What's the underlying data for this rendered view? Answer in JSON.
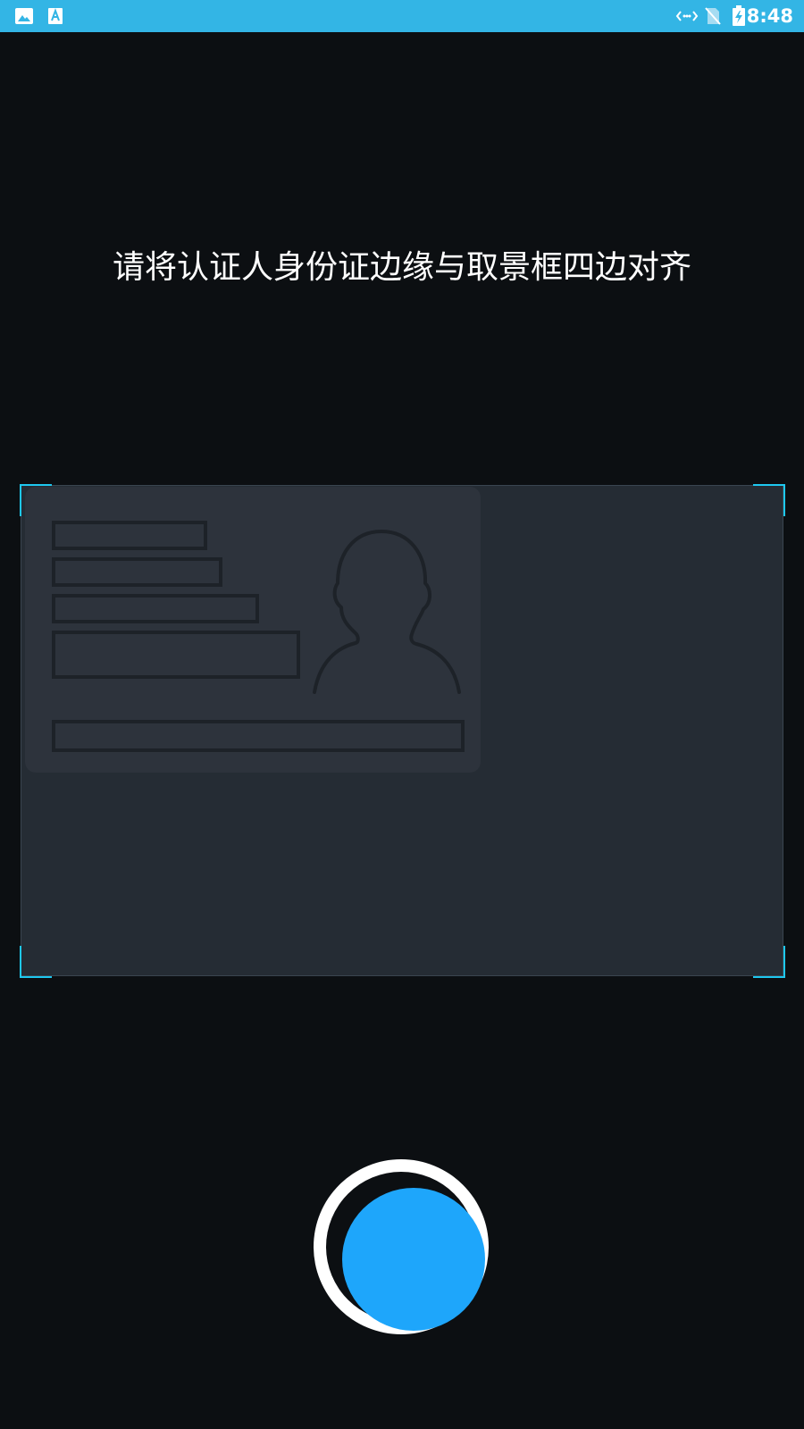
{
  "status_bar": {
    "time": "8:48",
    "left_icons": [
      "gallery-icon",
      "font-a-icon"
    ],
    "right_icons": [
      "data-sync-icon",
      "no-sim-icon",
      "battery-charging-icon"
    ],
    "background_color": "#33b5e5"
  },
  "instruction": {
    "text": "请将认证人身份证边缘与取景框四边对齐"
  },
  "viewfinder": {
    "frame_color": "#252c34",
    "corner_color": "#1ec8f0"
  },
  "shutter": {
    "outer_color": "#ffffff",
    "inner_color": "#1ea6fb"
  }
}
